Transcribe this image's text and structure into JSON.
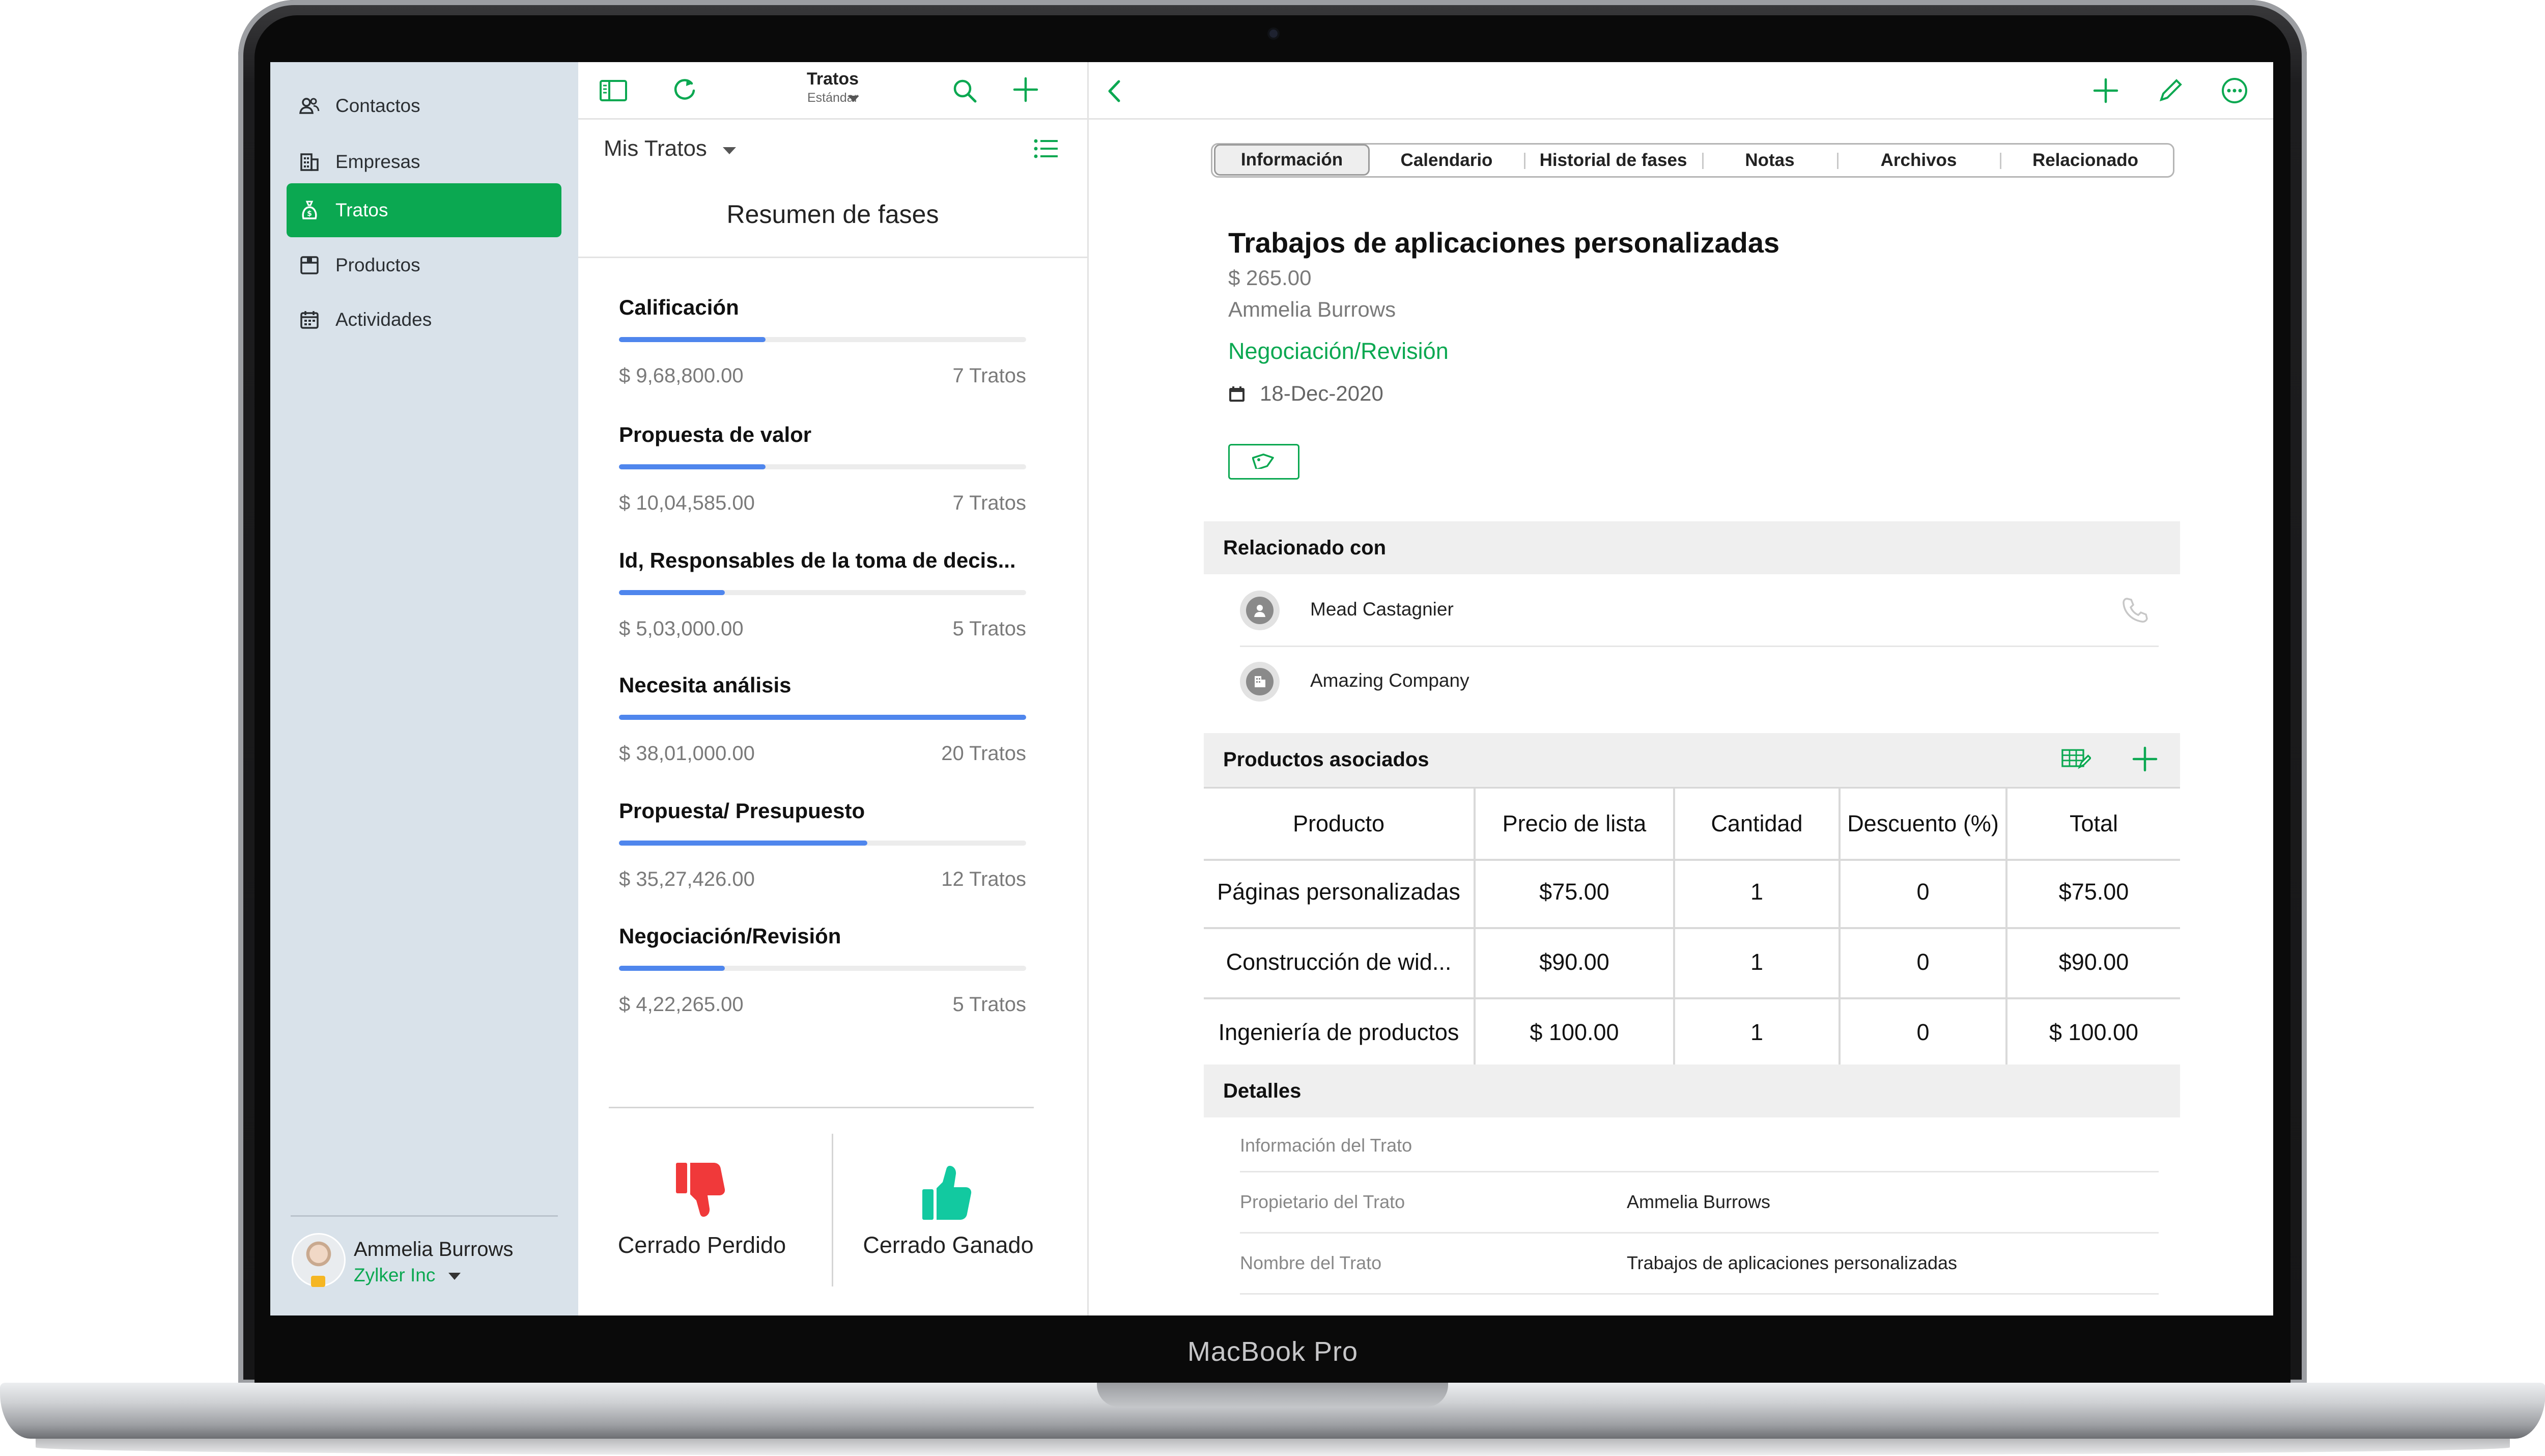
{
  "device": {
    "label": "MacBook Pro"
  },
  "sidebar": {
    "items": [
      {
        "label": "Contactos",
        "icon": "contacts-icon",
        "active": false
      },
      {
        "label": "Empresas",
        "icon": "companies-icon",
        "active": false
      },
      {
        "label": "Tratos",
        "icon": "deals-icon",
        "active": true
      },
      {
        "label": "Productos",
        "icon": "products-icon",
        "active": false
      },
      {
        "label": "Actividades",
        "icon": "activities-icon",
        "active": false
      }
    ],
    "user": {
      "name": "Ammelia Burrows",
      "org": "Zylker Inc"
    }
  },
  "list_panel": {
    "toolbar": {
      "title": "Tratos",
      "subtitle": "Estándar"
    },
    "view": {
      "label": "Mis Tratos"
    },
    "summary_title": "Resumen de fases",
    "stages": [
      {
        "name": "Calificación",
        "amount": "$ 9,68,800.00",
        "count": "7 Tratos",
        "progress": 0.36
      },
      {
        "name": "Propuesta de valor",
        "amount": "$ 10,04,585.00",
        "count": "7 Tratos",
        "progress": 0.36
      },
      {
        "name": "Id, Responsables de la toma de decis...",
        "amount": "$ 5,03,000.00",
        "count": "5 Tratos",
        "progress": 0.26
      },
      {
        "name": "Necesita análisis",
        "amount": "$ 38,01,000.00",
        "count": "20 Tratos",
        "progress": 1.0
      },
      {
        "name": "Propuesta/ Presupuesto",
        "amount": "$ 35,27,426.00",
        "count": "12 Tratos",
        "progress": 0.61
      },
      {
        "name": "Negociación/Revisión",
        "amount": "$ 4,22,265.00",
        "count": "5 Tratos",
        "progress": 0.26
      }
    ],
    "outcomes": {
      "lost": "Cerrado Perdido",
      "won": "Cerrado Ganado"
    }
  },
  "detail": {
    "tabs": [
      {
        "label": "Información",
        "active": true
      },
      {
        "label": "Calendario",
        "active": false
      },
      {
        "label": "Historial de fases",
        "active": false
      },
      {
        "label": "Notas",
        "active": false
      },
      {
        "label": "Archivos",
        "active": false
      },
      {
        "label": "Relacionado",
        "active": false
      }
    ],
    "deal": {
      "title": "Trabajos de aplicaciones personalizadas",
      "amount": "$ 265.00",
      "owner": "Ammelia Burrows",
      "stage": "Negociación/Revisión",
      "date": "18-Dec-2020"
    },
    "related": {
      "title": "Relacionado con",
      "items": [
        {
          "name": "Mead Castagnier",
          "type": "contact"
        },
        {
          "name": "Amazing Company",
          "type": "company"
        }
      ]
    },
    "products": {
      "title": "Productos asociados",
      "columns": [
        "Producto",
        "Precio de lista",
        "Cantidad",
        "Descuento (%)",
        "Total"
      ],
      "rows": [
        [
          "Páginas personalizadas",
          "$75.00",
          "1",
          "0",
          "$75.00"
        ],
        [
          "Construcción de wid...",
          "$90.00",
          "1",
          "0",
          "$90.00"
        ],
        [
          "Ingeniería de productos",
          "$ 100.00",
          "1",
          "0",
          "$ 100.00"
        ]
      ]
    },
    "details": {
      "title": "Detalles",
      "subheader": "Información del Trato",
      "fields": [
        {
          "label": "Propietario del Trato",
          "value": "Ammelia Burrows"
        },
        {
          "label": "Nombre del Trato",
          "value": "Trabajos de aplicaciones personalizadas"
        }
      ]
    }
  },
  "colors": {
    "accent": "#0ba851",
    "progress": "#4f86ed",
    "sidebar_bg": "#d9e2ea",
    "lost": "#f0393a",
    "won": "#12c9a0"
  }
}
